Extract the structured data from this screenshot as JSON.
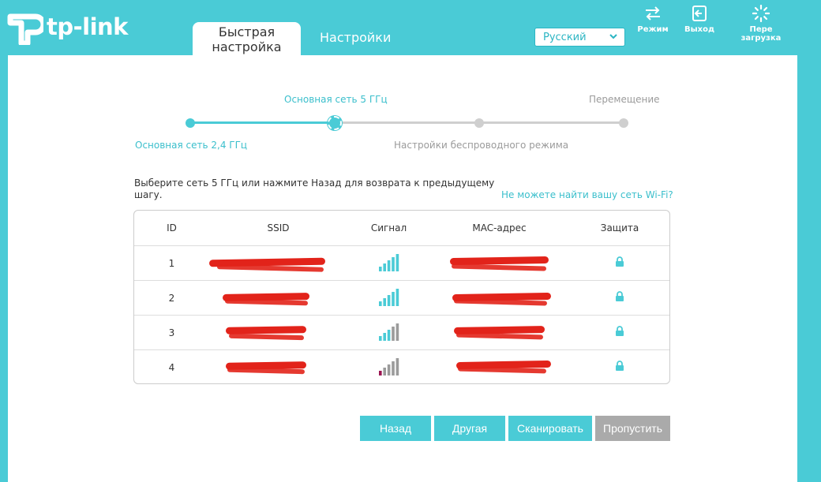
{
  "brand": {
    "name": "tp-link"
  },
  "tabs": [
    {
      "label_line1": "Быстрая",
      "label_line2": "настройка"
    },
    {
      "label": "Настройки"
    }
  ],
  "language": {
    "selected": "Русский"
  },
  "toolbar": {
    "mode_label": "Режим",
    "logout_label": "Выход",
    "reboot_label": "Пере загрузка"
  },
  "progress": {
    "step1": "Основная сеть 2,4 ГГц",
    "step2": "Основная сеть 5 ГГц",
    "step3": "Настройки беспроводного режима",
    "step4": "Перемещение"
  },
  "instruction": "Выберите сеть 5 ГГц или нажмите Назад для возврата к предыдущему шагу.",
  "help_link": "Не можете найти вашу сеть Wi-Fi?",
  "table": {
    "headers": {
      "id": "ID",
      "ssid": "SSID",
      "signal": "Сигнал",
      "mac": "MAC-адрес",
      "security": "Защита"
    },
    "rows": [
      {
        "id": "1",
        "signal_level": 5
      },
      {
        "id": "2",
        "signal_level": 5
      },
      {
        "id": "3",
        "signal_level": 3
      },
      {
        "id": "4",
        "signal_level": 1
      }
    ]
  },
  "buttons": {
    "back": "Назад",
    "other": "Другая",
    "scan": "Сканировать",
    "skip": "Пропустить"
  },
  "colors": {
    "accent": "#4acbd6",
    "active_text": "#3bbfcc",
    "disabled": "#aaaaaa",
    "redaction": "#e2231a",
    "weak_signal": "#9b1552"
  }
}
